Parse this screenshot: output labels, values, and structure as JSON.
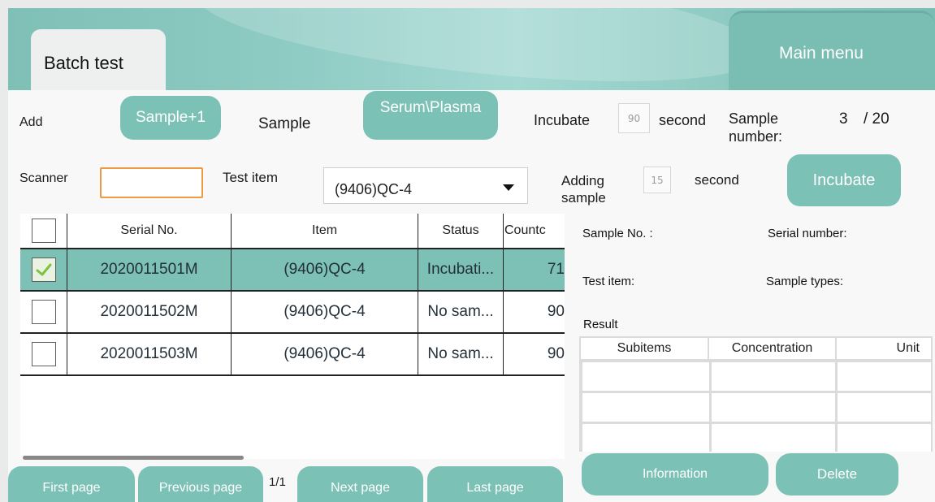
{
  "tabs": {
    "batch_test": "Batch test",
    "main_menu": "Main menu"
  },
  "controls": {
    "add_label": "Add",
    "add_button": "Sample+1",
    "sample_label": "Sample",
    "sample_type_button": "Serum\\Plasma",
    "incubate_label": "Incubate",
    "incubate_seconds": "90",
    "second_label": "second",
    "sample_number_label": "Sample number:",
    "sample_number_current": "3",
    "sample_number_total": "/ 20",
    "scanner_label": "Scanner",
    "scanner_value": "",
    "test_item_label": "Test item",
    "test_item_selected": "(9406)QC-4",
    "adding_sample_label": "Adding sample",
    "adding_seconds": "15",
    "second_label_2": "second",
    "incubate_button": "Incubate"
  },
  "table": {
    "columns": [
      "Serial No.",
      "Item",
      "Status",
      "Countc"
    ],
    "rows": [
      {
        "checked": true,
        "serial": "2020011501M",
        "item": "(9406)QC-4",
        "status": "Incubati...",
        "count": "71"
      },
      {
        "checked": false,
        "serial": "2020011502M",
        "item": "(9406)QC-4",
        "status": "No sam...",
        "count": "90"
      },
      {
        "checked": false,
        "serial": "2020011503M",
        "item": "(9406)QC-4",
        "status": "No sam...",
        "count": "90"
      }
    ]
  },
  "pagination": {
    "first": "First page",
    "previous": "Previous page",
    "indicator": "1/1",
    "next": "Next page",
    "last": "Last page"
  },
  "detail": {
    "sample_no_label": "Sample No. :",
    "serial_number_label": "Serial number:",
    "test_item_label": "Test item:",
    "sample_types_label": "Sample types:",
    "result_label": "Result",
    "result_columns": [
      "Subitems",
      "Concentration",
      "Unit"
    ],
    "information_button": "Information",
    "delete_button": "Delete"
  },
  "colors": {
    "accent": "#7cc1b6",
    "scanner_border": "#ee9a43"
  }
}
